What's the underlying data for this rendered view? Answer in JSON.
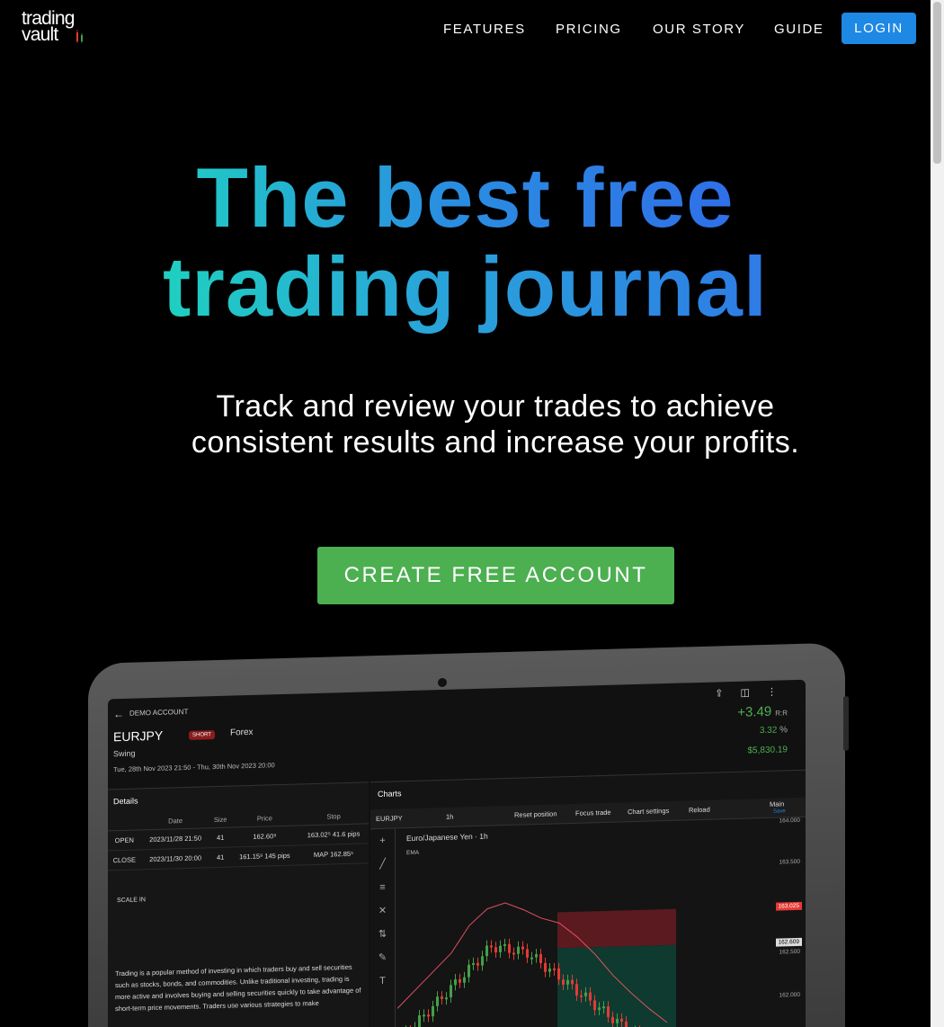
{
  "brand": {
    "logo_line1": "trading",
    "logo_line2": "vault"
  },
  "nav": {
    "items": [
      "FEATURES",
      "PRICING",
      "OUR STORY",
      "GUIDE"
    ],
    "login_label": "LOGIN"
  },
  "hero": {
    "title_line1": "The best free",
    "title_line2": "trading journal",
    "subtitle": "Track and review your trades to achieve consistent results and increase your profits.",
    "cta_label": "CREATE FREE ACCOUNT"
  },
  "colors": {
    "accent_blue": "#1e88e5",
    "cta_green": "#4caf50",
    "gradient_start": "#21c7c7",
    "gradient_end": "#2f6fe8"
  },
  "app_preview": {
    "account_label": "DEMO ACCOUNT",
    "pair": "EURJPY",
    "side_badge": "SHORT",
    "market": "Forex",
    "style": "Swing",
    "date_range": "Tue, 28th Nov 2023 21:50 - Thu, 30th Nov 2023 20:00",
    "rr_value": "+3.49",
    "rr_unit": "R:R",
    "pct_value": "3.32",
    "pct_unit": "%",
    "usd_value": "$5,830.19",
    "details_title": "Details",
    "table_headers": [
      "",
      "Date",
      "Size",
      "Price",
      "Stop"
    ],
    "table_rows": [
      [
        "OPEN",
        "2023/11/28 21:50",
        "41",
        "162.60⁹",
        "163.02⁵ 41.6 pips"
      ],
      [
        "CLOSE",
        "2023/11/30 20:00",
        "41",
        "161.15⁹ 145 pips",
        "MAP 162.85⁵"
      ]
    ],
    "scale_in_label": "SCALE IN",
    "description": "Trading is a popular method of investing in which traders buy and sell securities such as stocks, bonds, and commodities. Unlike traditional investing, trading is more active and involves buying and selling securities quickly to take advantage of short-term price movements. Traders use various strategies to make",
    "charts_title": "Charts",
    "toolbar": [
      "EURJPY",
      "1h",
      "Reset position",
      "Focus trade",
      "Chart settings",
      "Reload",
      "Main"
    ],
    "toolbar_sub": "Save",
    "symbol_title": "Euro/Japanese Yen · 1h",
    "indicator": "EMA",
    "y_ticks": [
      "164.000",
      "163.500",
      "163.025",
      "162.609",
      "162.500",
      "162.000"
    ]
  }
}
